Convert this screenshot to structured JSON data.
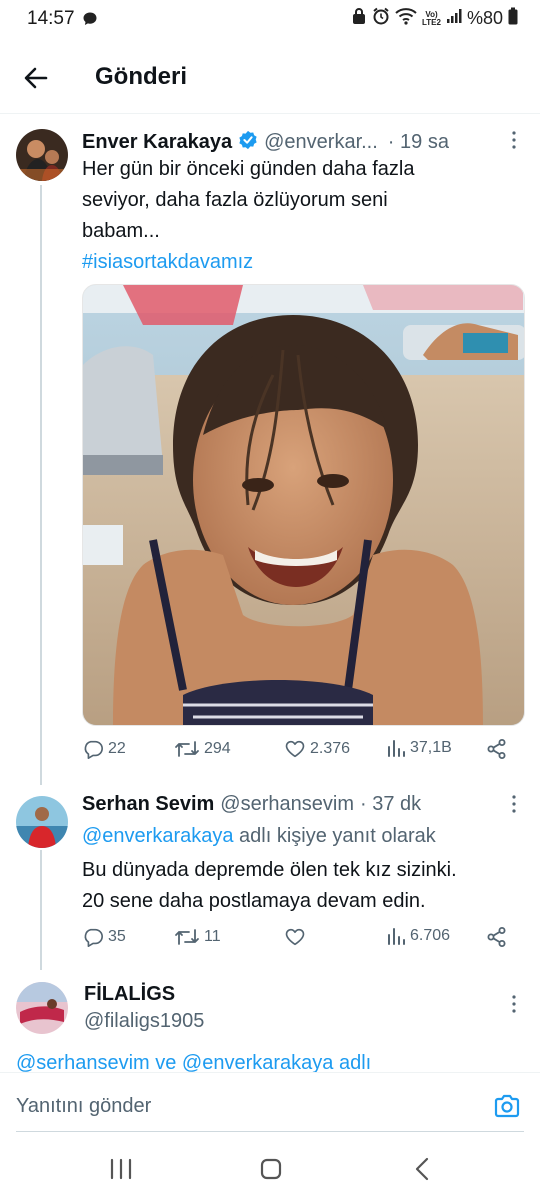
{
  "status_bar": {
    "time": "14:57",
    "battery": "%80",
    "lte_top": "Vo)",
    "lte_bottom": "LTE2"
  },
  "header": {
    "title": "Gönderi"
  },
  "main_tweet": {
    "name": "Enver Karakaya",
    "handle": "@enverkar...",
    "time": "· 19 sa",
    "text_lines": [
      "Her gün bir önceki günden daha fazla",
      "seviyor, daha fazla özlüyorum seni",
      "babam..."
    ],
    "hashtag": "#isiasortakdavamız",
    "stats": {
      "replies": "22",
      "retweets": "294",
      "likes": "2.376",
      "views": "37,1B"
    }
  },
  "reply_tweet": {
    "name": "Serhan Sevim",
    "handle": "@serhansevim",
    "time": "· 37 dk",
    "replying_mention": "@enverkarakaya",
    "replying_suffix": "adlı kişiye yanıt olarak",
    "text_lines": [
      "Bu dünyada depremde ölen tek kız sizinki.",
      "20 sene daha postlamaya devam edin."
    ],
    "stats": {
      "replies": "35",
      "retweets": "11",
      "likes": "",
      "views": "6.706"
    }
  },
  "third_tweet": {
    "name": "FİLALİGS",
    "handle": "@filaligs1905",
    "replying_partial": "@serhansevim ve @enverkarakaya adlı"
  },
  "reply_bar": {
    "placeholder": "Yanıtını gönder"
  },
  "colors": {
    "accent": "#1d9bf0",
    "verified": "#1d9bf0",
    "muted": "#536471",
    "text": "#0f1419",
    "thread_line": "#cfd9de"
  }
}
